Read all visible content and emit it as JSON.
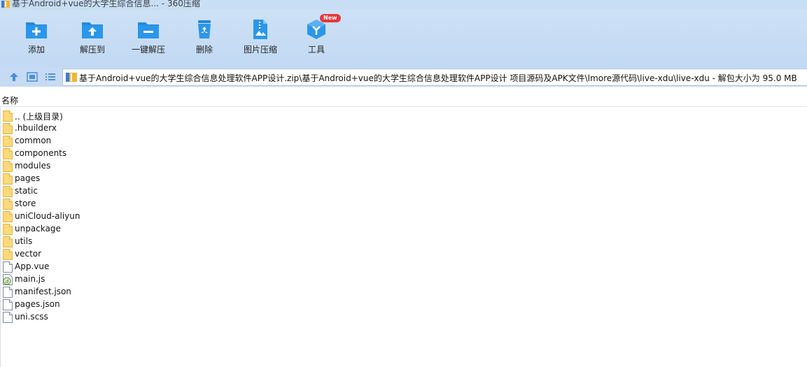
{
  "window": {
    "title": "基于Android+vue的大学生综合信息... - 360压缩"
  },
  "toolbar": {
    "add": "添加",
    "extract_to": "解压到",
    "one_click_extract": "一键解压",
    "delete": "删除",
    "image_compress": "图片压缩",
    "tools": "工具",
    "new_badge": "New"
  },
  "address": {
    "path": "基于Android+vue的大学生综合信息处理软件APP设计.zip\\基于Android+vue的大学生综合信息处理软件APP设计 项目源码及APK文件\\lmore源代码\\live-xdu\\live-xdu - 解包大小为 95.0 MB"
  },
  "columns": {
    "name": "名称"
  },
  "files": [
    {
      "name": ".. (上级目录)",
      "icon": "folder-icon"
    },
    {
      "name": ".hbuilderx",
      "icon": "folder-icon"
    },
    {
      "name": "common",
      "icon": "folder-icon"
    },
    {
      "name": "components",
      "icon": "folder-icon"
    },
    {
      "name": "modules",
      "icon": "folder-icon"
    },
    {
      "name": "pages",
      "icon": "folder-icon"
    },
    {
      "name": "static",
      "icon": "folder-icon"
    },
    {
      "name": "store",
      "icon": "folder-icon"
    },
    {
      "name": "uniCloud-aliyun",
      "icon": "folder-icon"
    },
    {
      "name": "unpackage",
      "icon": "folder-icon"
    },
    {
      "name": "utils",
      "icon": "folder-icon"
    },
    {
      "name": "vector",
      "icon": "folder-icon"
    },
    {
      "name": "App.vue",
      "icon": "file-icon"
    },
    {
      "name": "main.js",
      "icon": "js-file-icon"
    },
    {
      "name": "manifest.json",
      "icon": "file-icon"
    },
    {
      "name": "pages.json",
      "icon": "file-icon"
    },
    {
      "name": "uni.scss",
      "icon": "file-icon"
    }
  ]
}
